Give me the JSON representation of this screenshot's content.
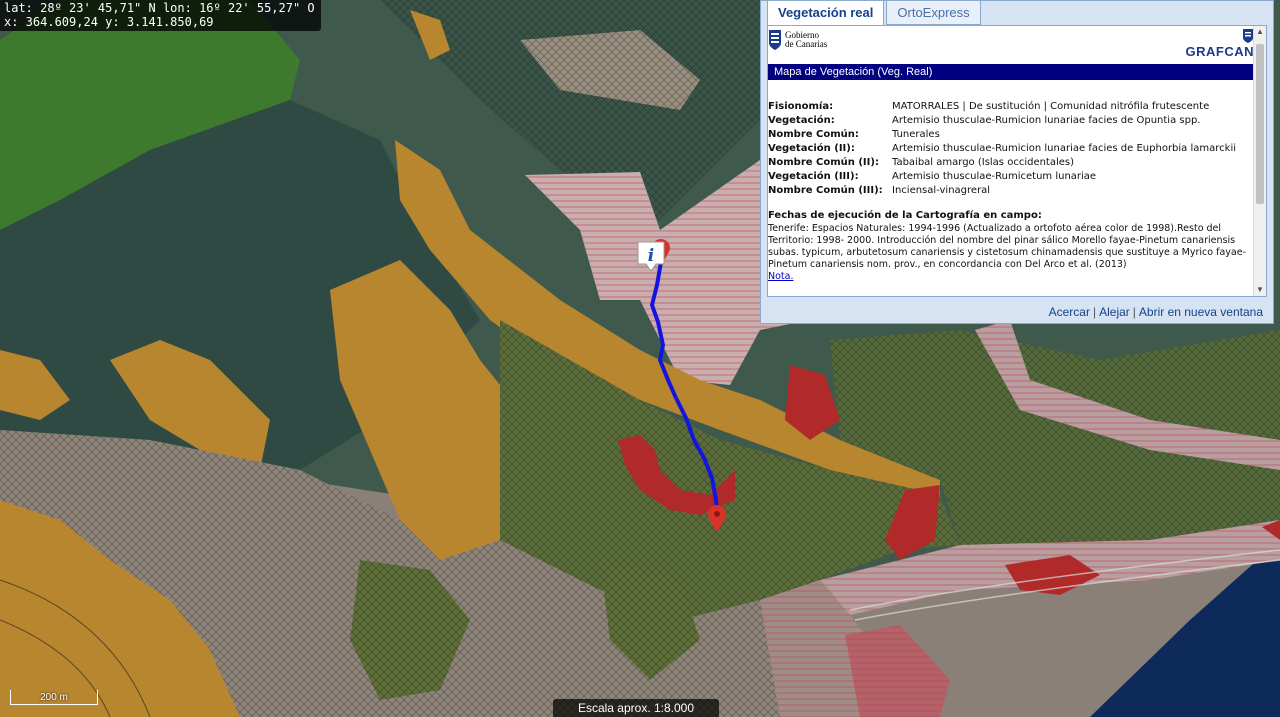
{
  "coords": {
    "latlon": "lat: 28º 23' 45,71\" N  lon: 16º 22' 55,27\" O",
    "xy": "x: 364.609,24  y: 3.141.850,69"
  },
  "scale": {
    "bar_label": "200 m",
    "text": "Escala aprox. 1:8.000"
  },
  "popup": {
    "tabs": [
      "Vegetación real",
      "OrtoExpress"
    ],
    "gobierno": [
      "Gobierno",
      "de Canarias"
    ],
    "grafcan": "GRAFCAN",
    "header": "Mapa de Vegetación (Veg. Real)",
    "rows": [
      {
        "k": "Fisionomía:",
        "v": "MATORRALES | De sustitución | Comunidad nitrófila frutescente"
      },
      {
        "k": "Vegetación:",
        "v": "Artemisio thusculae-Rumicion lunariae facies de Opuntia spp."
      },
      {
        "k": "Nombre Común:",
        "v": "Tunerales"
      },
      {
        "k": "Vegetación (II):",
        "v": "Artemisio thusculae-Rumicion lunariae facies de Euphorbia lamarckii"
      },
      {
        "k": "Nombre Común (II):",
        "v": "Tabaibal amargo (Islas occidentales)"
      },
      {
        "k": "Vegetación (III):",
        "v": "Artemisio thusculae-Rumicetum lunariae"
      },
      {
        "k": "Nombre Común (III):",
        "v": "Inciensal-vinagreral"
      }
    ],
    "fechas_title": "Fechas de ejecución de la Cartografía en campo:",
    "fechas_text": "Tenerife: Espacios Naturales: 1994-1996 (Actualizado a ortofoto aérea color de 1998).Resto del Territorio: 1998- 2000. Introducción del nombre del pinar sálico Morello fayae-Pinetum canariensis subas. typicum, arbutetosum canariensis y cistetosum chinamadensis que sustituye a Myrico fayae-Pinetum canariensis nom. prov., en concordancia con Del Arco et al. (2013)",
    "nota": "Nota.",
    "links": [
      "Acercar",
      "Alejar",
      "Abrir en nueva ventana"
    ]
  },
  "map": {
    "info_marker": "i"
  }
}
